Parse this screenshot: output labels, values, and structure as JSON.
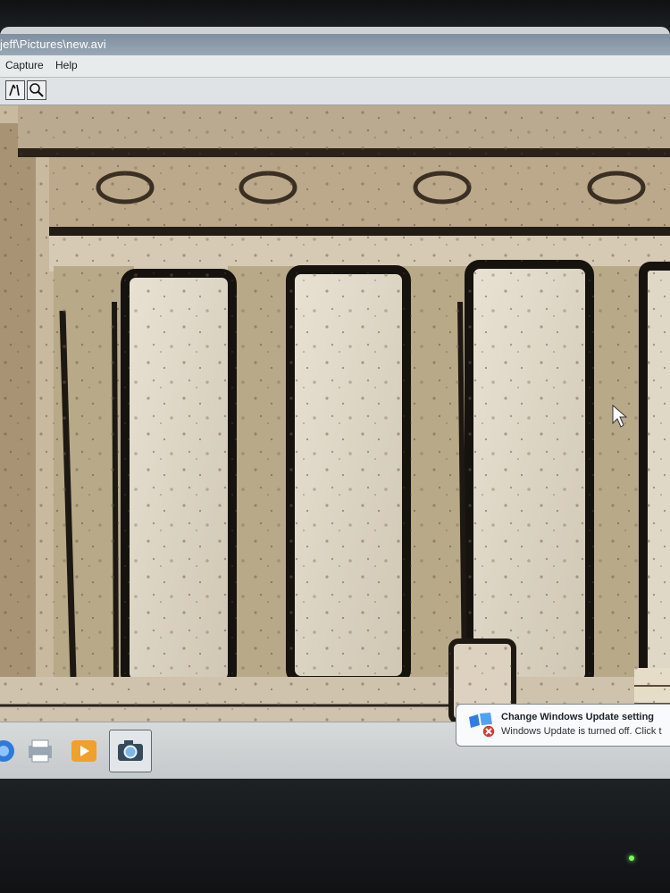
{
  "window": {
    "title": "jeff\\Pictures\\new.avi"
  },
  "menu": {
    "items": [
      {
        "label": "Capture"
      },
      {
        "label": "Help"
      }
    ]
  },
  "toolbar": {
    "tools": [
      {
        "icon": "pen-tool-icon"
      },
      {
        "icon": "zoom-icon"
      }
    ]
  },
  "notification": {
    "title": "Change Windows Update setting",
    "body": "Windows Update is turned off. Click t",
    "icon": "windows-flag-warning-icon"
  },
  "taskbar": {
    "icons": [
      "ie-icon",
      "printer-icon",
      "media-player-icon",
      "camera-icon"
    ]
  },
  "colors": {
    "accent": "#7f8fa0",
    "led": "#7cff5a"
  }
}
